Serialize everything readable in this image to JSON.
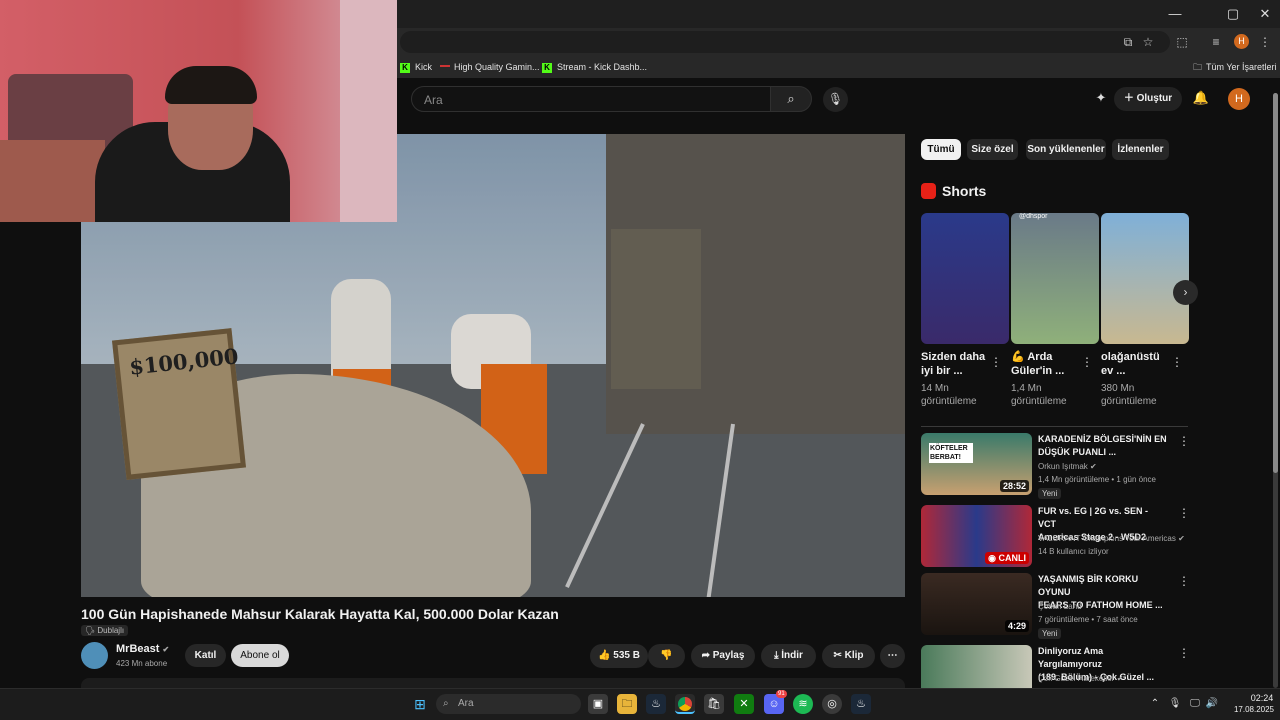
{
  "browser": {
    "window_controls": {
      "minimize": "—",
      "maximize": "▢",
      "close": "✕"
    },
    "bookmarks": [
      {
        "label": "Kick",
        "icon": "kick-icon"
      },
      {
        "label": "High Quality Gamin...",
        "icon": "red-bar-icon"
      },
      {
        "label": "Stream - Kick Dashb...",
        "icon": "kick-icon"
      }
    ],
    "all_bookmarks": "Tüm Yer İşaretleri",
    "profile_initial": "H"
  },
  "header": {
    "search_placeholder": "Ara",
    "create_label": "Oluştur",
    "avatar_initial": "H"
  },
  "video": {
    "title": "100 Gün Hapishanede Mahsur Kalarak Hayatta Kal, 500.000 Dolar Kazan",
    "dubbed_badge": "Dublajlı",
    "sign_text": "$100,000",
    "channel": {
      "name": "MrBeast",
      "subscribers": "423 Mn abone"
    },
    "join_label": "Katıl",
    "subscribe_label": "Abone ol",
    "likes": "535 B",
    "share_label": "Paylaş",
    "download_label": "İndir",
    "clip_label": "Klip"
  },
  "sidebar": {
    "chips": [
      {
        "label": "Tümü",
        "active": true
      },
      {
        "label": "Size özel",
        "active": false
      },
      {
        "label": "Son yüklenenler",
        "active": false
      },
      {
        "label": "İzlenenler",
        "active": false
      }
    ],
    "shorts_heading": "Shorts",
    "shorts": [
      {
        "title_line1": "Sizden daha",
        "title_line2": "iyi bir ...",
        "views_line1": "14 Mn",
        "views_line2": "görüntüleme"
      },
      {
        "title_line1": "💪 Arda",
        "title_line2": "Güler'in ...",
        "views_line1": "1,4 Mn",
        "views_line2": "görüntüleme",
        "thumb_text": "@dhspor"
      },
      {
        "title_line1": "olağanüstü",
        "title_line2": "ev ...",
        "views_line1": "380 Mn",
        "views_line2": "görüntüleme"
      }
    ],
    "recommended": [
      {
        "title_line1": "KARADENİZ BÖLGESİ'NİN EN",
        "title_line2": "DÜŞÜK PUANLI ...",
        "channel": "Orkun Işıtmak",
        "meta": "1,4 Mn görüntüleme • 1 gün önce",
        "badge": "Yeni",
        "duration": "28:52",
        "thumb_text": "KÖFTELER BERBAT!"
      },
      {
        "title_line1": "FUR vs. EG |  2G vs. SEN  - VCT",
        "title_line2": "Americas Stage 2 - W5D2",
        "channel": "VALORANT Champions Tour Americas",
        "meta": "14 B kullanıcı izliyor",
        "badge": "",
        "duration": "",
        "live_label": "CANLI"
      },
      {
        "title_line1": "YAŞANMIŞ BİR KORKU OYUNU",
        "title_line2": "FEARS TO FATHOM HOME ...",
        "channel": "Çoban Land",
        "meta": "7 görüntüleme • 7 saat önce",
        "badge": "Yeni",
        "duration": "4:29"
      },
      {
        "title_line1": "Dinliyoruz Ama Yargılamıyoruz",
        "title_line2": "(189. Bölüm) - Çok Güzel ...",
        "channel": "Çok Güzel Hareketler",
        "meta": "",
        "badge": "",
        "duration": ""
      }
    ]
  },
  "taskbar": {
    "search_placeholder": "Ara",
    "discord_badge": "91",
    "time": "02:24",
    "date": "17.08.2025"
  },
  "colors": {
    "accent": "#ff0000",
    "avatar": "#d2691e",
    "kick": "#53fc18",
    "background": "#0f0f0f"
  }
}
